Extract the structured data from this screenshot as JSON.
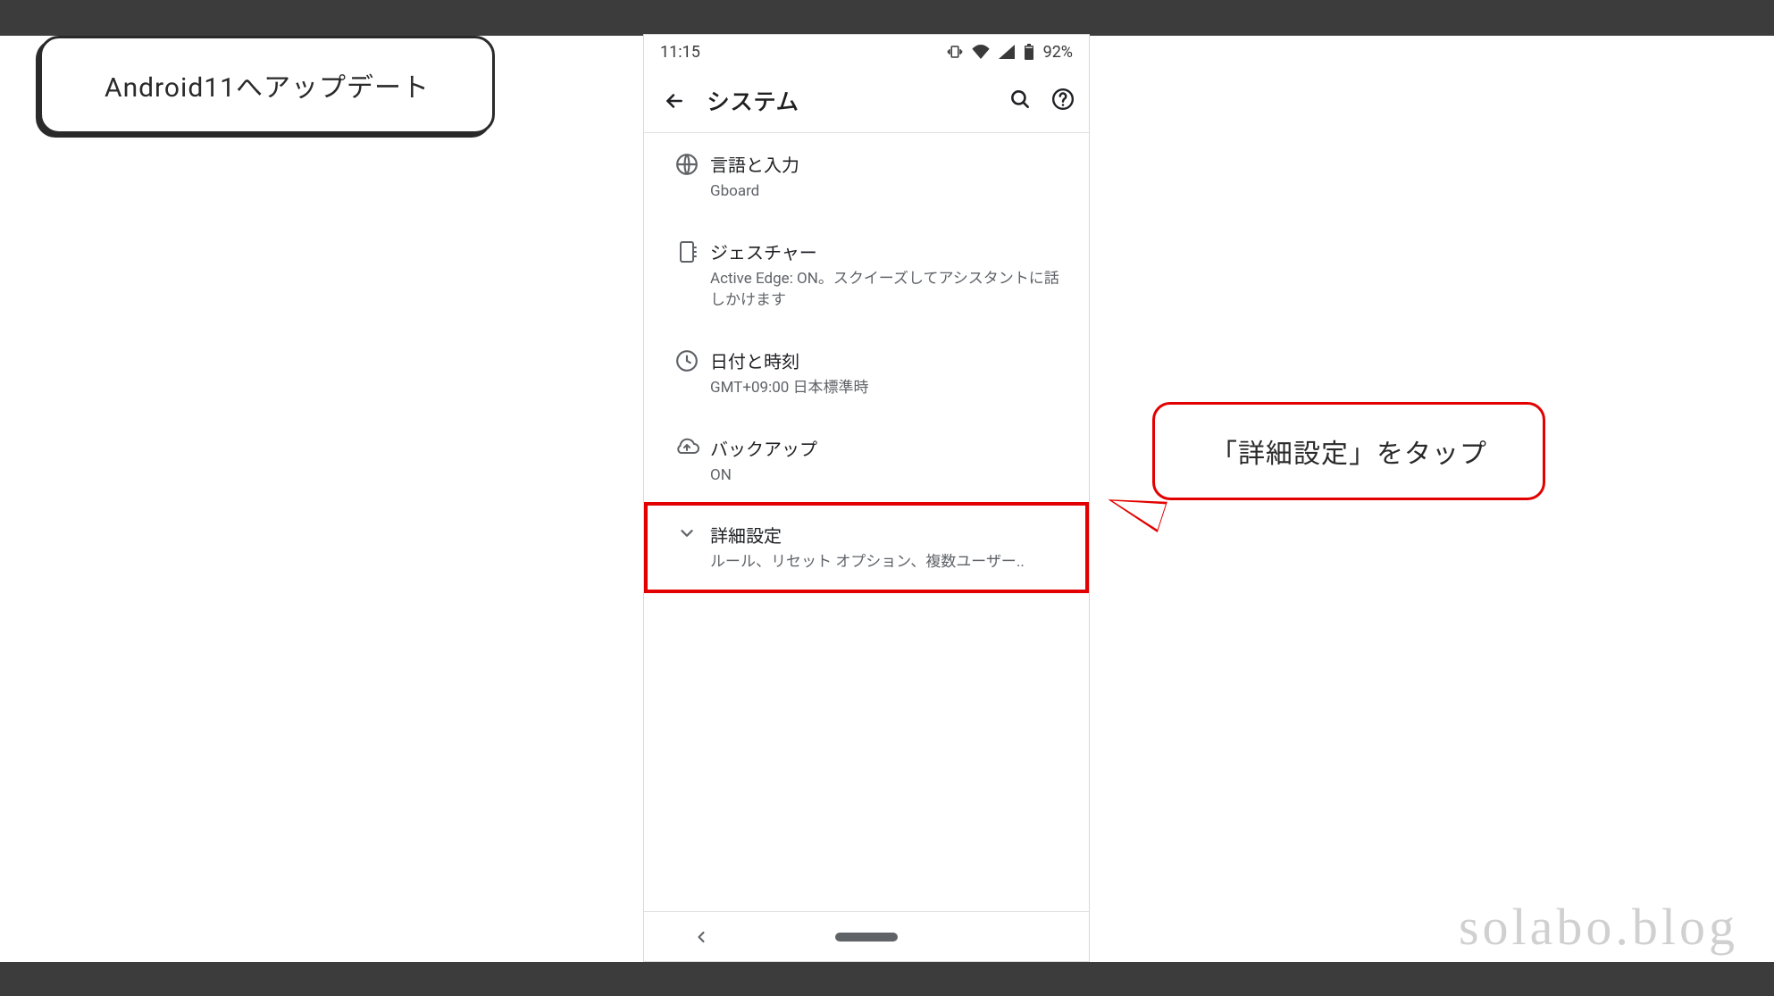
{
  "banners": {
    "title": "Android11へアップデート",
    "callout": "「詳細設定」をタップ",
    "watermark": "solabo.blog"
  },
  "status": {
    "time": "11:15",
    "battery_text": "92%"
  },
  "appbar": {
    "title": "システム"
  },
  "rows": [
    {
      "title": "言語と入力",
      "sub": "Gboard"
    },
    {
      "title": "ジェスチャー",
      "sub": "Active Edge: ON。スクイーズしてアシスタントに話しかけます"
    },
    {
      "title": "日付と時刻",
      "sub": "GMT+09:00 日本標準時"
    },
    {
      "title": "バックアップ",
      "sub": "ON"
    },
    {
      "title": "詳細設定",
      "sub": "ルール、リセット オプション、複数ユーザー.."
    }
  ],
  "highlight": {
    "row_index": 4
  }
}
